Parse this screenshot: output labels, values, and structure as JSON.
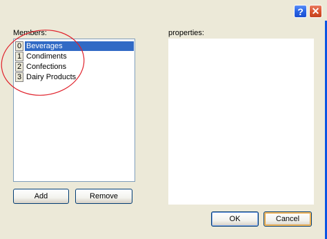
{
  "titlebar": {
    "help_icon": "?",
    "close_icon": "✕"
  },
  "members": {
    "label": "Members:",
    "items": [
      {
        "index": "0",
        "label": "Beverages",
        "selected": true
      },
      {
        "index": "1",
        "label": "Condiments",
        "selected": false
      },
      {
        "index": "2",
        "label": "Confections",
        "selected": false
      },
      {
        "index": "3",
        "label": "Dairy Products",
        "selected": false
      }
    ]
  },
  "properties": {
    "label": "properties:"
  },
  "buttons": {
    "add": "Add",
    "remove": "Remove",
    "ok": "OK",
    "cancel": "Cancel"
  },
  "colors": {
    "selection": "#316ac5",
    "annotation": "#e0202a"
  }
}
